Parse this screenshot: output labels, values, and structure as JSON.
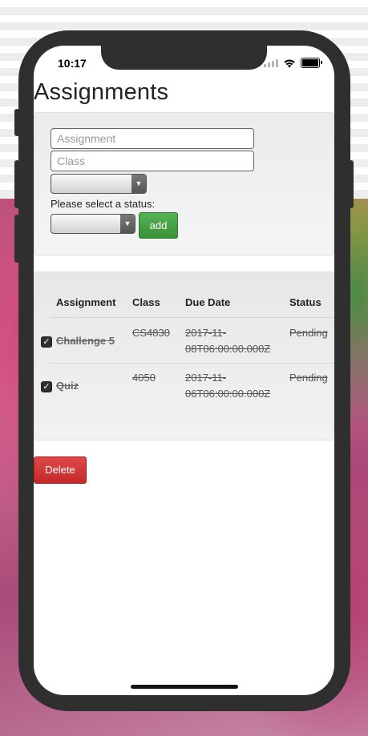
{
  "status_bar": {
    "time": "10:17"
  },
  "page": {
    "title": "Assignments"
  },
  "form": {
    "assignment_placeholder": "Assignment",
    "class_placeholder": "Class",
    "status_prompt": "Please select a status:",
    "add_label": "add"
  },
  "table": {
    "headers": [
      "Assignment",
      "Class",
      "Due Date",
      "Status"
    ],
    "rows": [
      {
        "assignment": "Challenge 5",
        "class": "CS4830",
        "due_line1": "2017-11-",
        "due_line2": "08T06:00:00.000Z",
        "status": "Pending",
        "checked": true
      },
      {
        "assignment": "Quiz",
        "class": "4050",
        "due_line1": "2017-11-",
        "due_line2": "06T06:00:00.000Z",
        "status": "Pending",
        "checked": true
      }
    ]
  },
  "actions": {
    "delete_label": "Delete"
  },
  "colors": {
    "add_button": "#4ca64c",
    "delete_button": "#d43a3a",
    "phone_frame": "#2f2f2f"
  },
  "icons": [
    "wifi-icon",
    "battery-icon",
    "signal-icon",
    "checkmark-icon",
    "dropdown-arrow-icon"
  ]
}
